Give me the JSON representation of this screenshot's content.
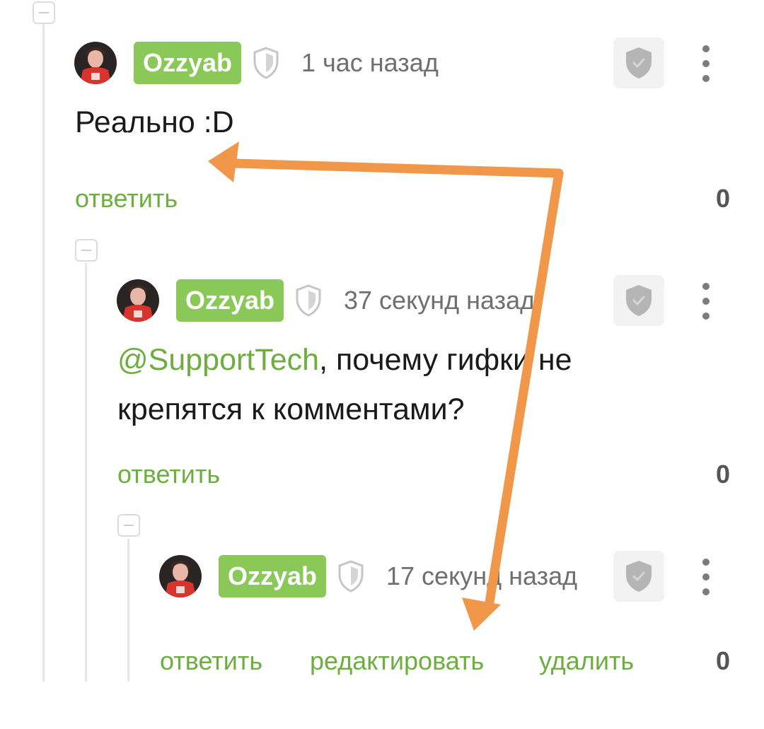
{
  "comments": [
    {
      "author": "Ozzyab",
      "time": "1 час назад",
      "text": "Реально :D",
      "actions": {
        "reply": "ответить"
      },
      "rating": "0"
    },
    {
      "author": "Ozzyab",
      "time": "37 секунд назад",
      "mention": "@SupportTech",
      "text": ", почему гифки не крепятся к комментами?",
      "actions": {
        "reply": "ответить"
      },
      "rating": "0"
    },
    {
      "author": "Ozzyab",
      "time": "17 секунд назад",
      "actions": {
        "reply": "ответить",
        "edit": "редактировать",
        "delete": "удалить"
      },
      "rating": "0"
    }
  ],
  "colors": {
    "accent": "#8ac858",
    "link": "#6eae40",
    "arrow": "#f0974a"
  },
  "icons": [
    "collapse-icon",
    "shield-icon",
    "moderation-shield-icon",
    "more-vertical-icon"
  ]
}
